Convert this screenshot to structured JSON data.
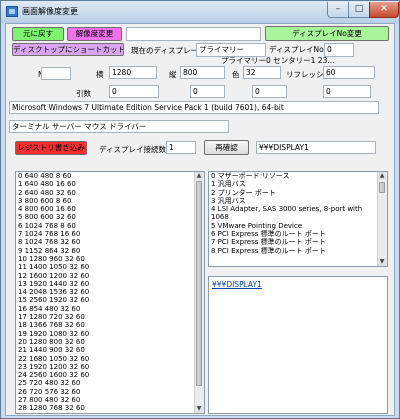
{
  "window": {
    "title": "画面解像度変更",
    "minimize": "–",
    "maximize": "□",
    "close": "✕"
  },
  "buttons": {
    "restore": "元に戻す",
    "change_resolution": "解像度変更",
    "display_no_change": "ディスプレイNo変更",
    "create_shortcut": "ディスクトップにショートカットを作る",
    "registry_write": "レジストリ書き込み",
    "recheck": "再確認"
  },
  "fields": {
    "top_blank": "",
    "current_display_label": "現在のディスプレーは",
    "current_display_value": "プライマリー",
    "display_no_label": "ディスプレイNo",
    "display_no_value": "0",
    "primary_center_note": "プライマリー0  センタリー1 23...",
    "no_label": "No",
    "no_value": "",
    "width_label": "横",
    "width_value": "1280",
    "height_label": "縦",
    "height_value": "800",
    "color_label": "色",
    "color_value": "32",
    "refresh_label": "リフレッシュ",
    "refresh_value": "60",
    "arg_label": "引数",
    "arg1": "0",
    "arg2": "0",
    "arg3": "0",
    "arg4": "0",
    "os_info": "Microsoft Windows 7 Ultimate Edition Service Pack 1 (build 7601), 64-bit",
    "drivers": "ターミナル サーバー マウス ドライバー",
    "display_count_label": "ディスプレイ接続数",
    "display_count": "1",
    "display_path": "¥¥¥DISPLAY1"
  },
  "modes": [
    "0 640 480 8 60",
    "1 640 480 16 60",
    "2 640 480 32 60",
    "3 800 600 8 60",
    "4 800 600 16 60",
    "5 800 600 32 60",
    "6 1024 768 8 60",
    "7 1024 768 16 60",
    "8 1024 768 32 60",
    "9 1152 864 32 60",
    "10 1280 960 32 60",
    "11 1400 1050 32 60",
    "12 1600 1200 32 60",
    "13 1920 1440 32 60",
    "14 2048 1536 32 60",
    "15 2560 1920 32 60",
    "16 854 480 32 60",
    "17 1280 720 32 60",
    "18 1366 768 32 60",
    "19 1920 1080 32 60",
    "20 1280 800 32 60",
    "21 1440 900 32 60",
    "22 1680 1050 32 60",
    "23 1920 1200 32 60",
    "24 2560 1600 32 60",
    "25 720 480 32 60",
    "26 720 576 32 60",
    "27 800 480 32 60",
    "28 1280 768 32 60"
  ],
  "devices": [
    "0 マザーボード リソース",
    "1 汎用バス",
    "2 プリンター ポート",
    "3 汎用バス",
    "4 LSI Adapter, SAS 3000 series, 8-port with",
    "1068",
    "5 VMware Pointing Device",
    "6 PCI Express 標準のルート ポート",
    "7 PCI Express 標準のルート ポート",
    "8 PCI Express 標準のルート ポート"
  ],
  "display_link": "¥¥¥DISPLAY1",
  "scroll": {
    "up": "▲",
    "down": "▼"
  }
}
